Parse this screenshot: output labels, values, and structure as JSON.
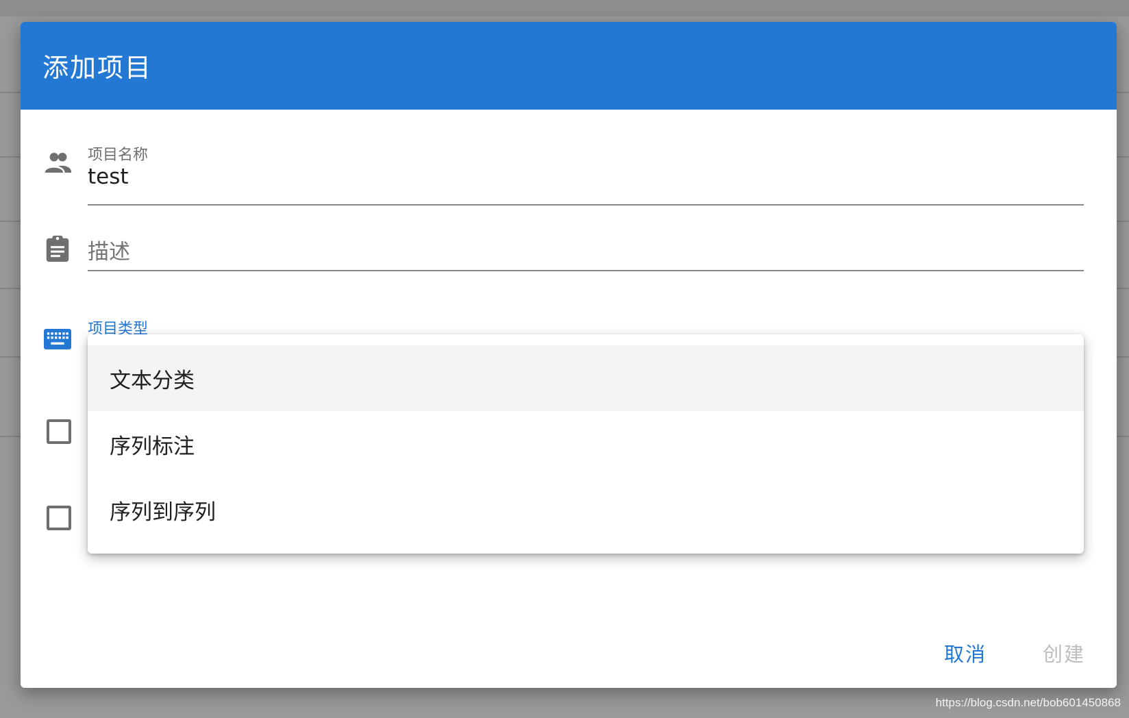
{
  "dialog": {
    "title": "添加项目",
    "fields": {
      "project_name": {
        "label": "项目名称",
        "value": "test",
        "icon": "people-icon"
      },
      "description": {
        "placeholder": "描述",
        "icon": "clipboard-icon"
      },
      "project_type": {
        "label": "项目类型",
        "icon": "keyboard-icon"
      }
    },
    "type_menu": {
      "options": [
        "文本分类",
        "序列标注",
        "序列到序列"
      ],
      "highlighted_index": 0
    },
    "checkboxes": [
      {
        "checked": false
      },
      {
        "checked": false
      }
    ],
    "actions": {
      "cancel": "取消",
      "create": "创建"
    }
  },
  "watermark": "https://blog.csdn.net/bob601450868",
  "colors": {
    "accent": "#2378d4",
    "header_bg": "#2378d4",
    "disabled_text": "#bdbdbd",
    "overlay": "#9a9a9a"
  }
}
